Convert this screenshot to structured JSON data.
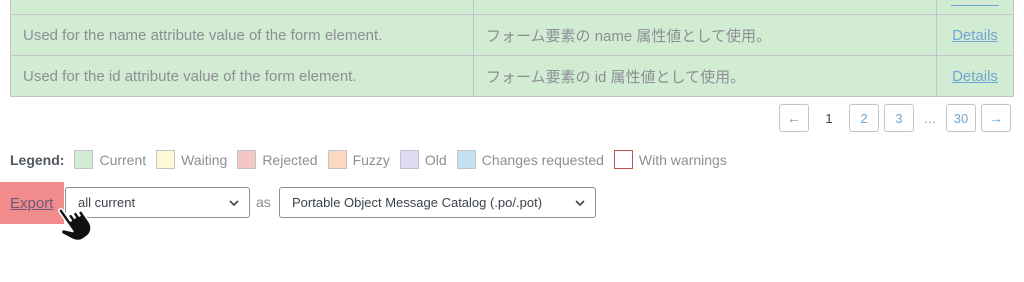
{
  "table": {
    "rows": [
      {
        "source": "",
        "translation": "",
        "details": ""
      },
      {
        "source": "Used for the name attribute value of the form element.",
        "translation": "フォーム要素の name 属性値として使用。",
        "details": "Details"
      },
      {
        "source": "Used for the id attribute value of the form element.",
        "translation": "フォーム要素の id 属性値として使用。",
        "details": "Details"
      }
    ]
  },
  "pagination": {
    "prev": "←",
    "current": "1",
    "pages": [
      "2",
      "3"
    ],
    "ellipsis": "…",
    "last": "30",
    "next": "→"
  },
  "legend": {
    "label": "Legend:",
    "items": [
      {
        "label": "Current",
        "color": "#d2ebd3"
      },
      {
        "label": "Waiting",
        "color": "#fef8d8"
      },
      {
        "label": "Rejected",
        "color": "#f5c6c6"
      },
      {
        "label": "Fuzzy",
        "color": "#fbd9c0"
      },
      {
        "label": "Old",
        "color": "#dedcf0"
      },
      {
        "label": "Changes requested",
        "color": "#c3e3f2"
      },
      {
        "label": "With warnings",
        "color": "#ffffff",
        "border": "#c0504d"
      }
    ]
  },
  "export": {
    "button": "Export",
    "filter_value": "all current",
    "as_label": "as",
    "format_value": "Portable Object Message Catalog (.po/.pot)",
    "highlight_color": "#f28c8c"
  },
  "icons": {
    "chevron": "chevron-down-icon",
    "cursor": "hand-pointer-icon"
  }
}
